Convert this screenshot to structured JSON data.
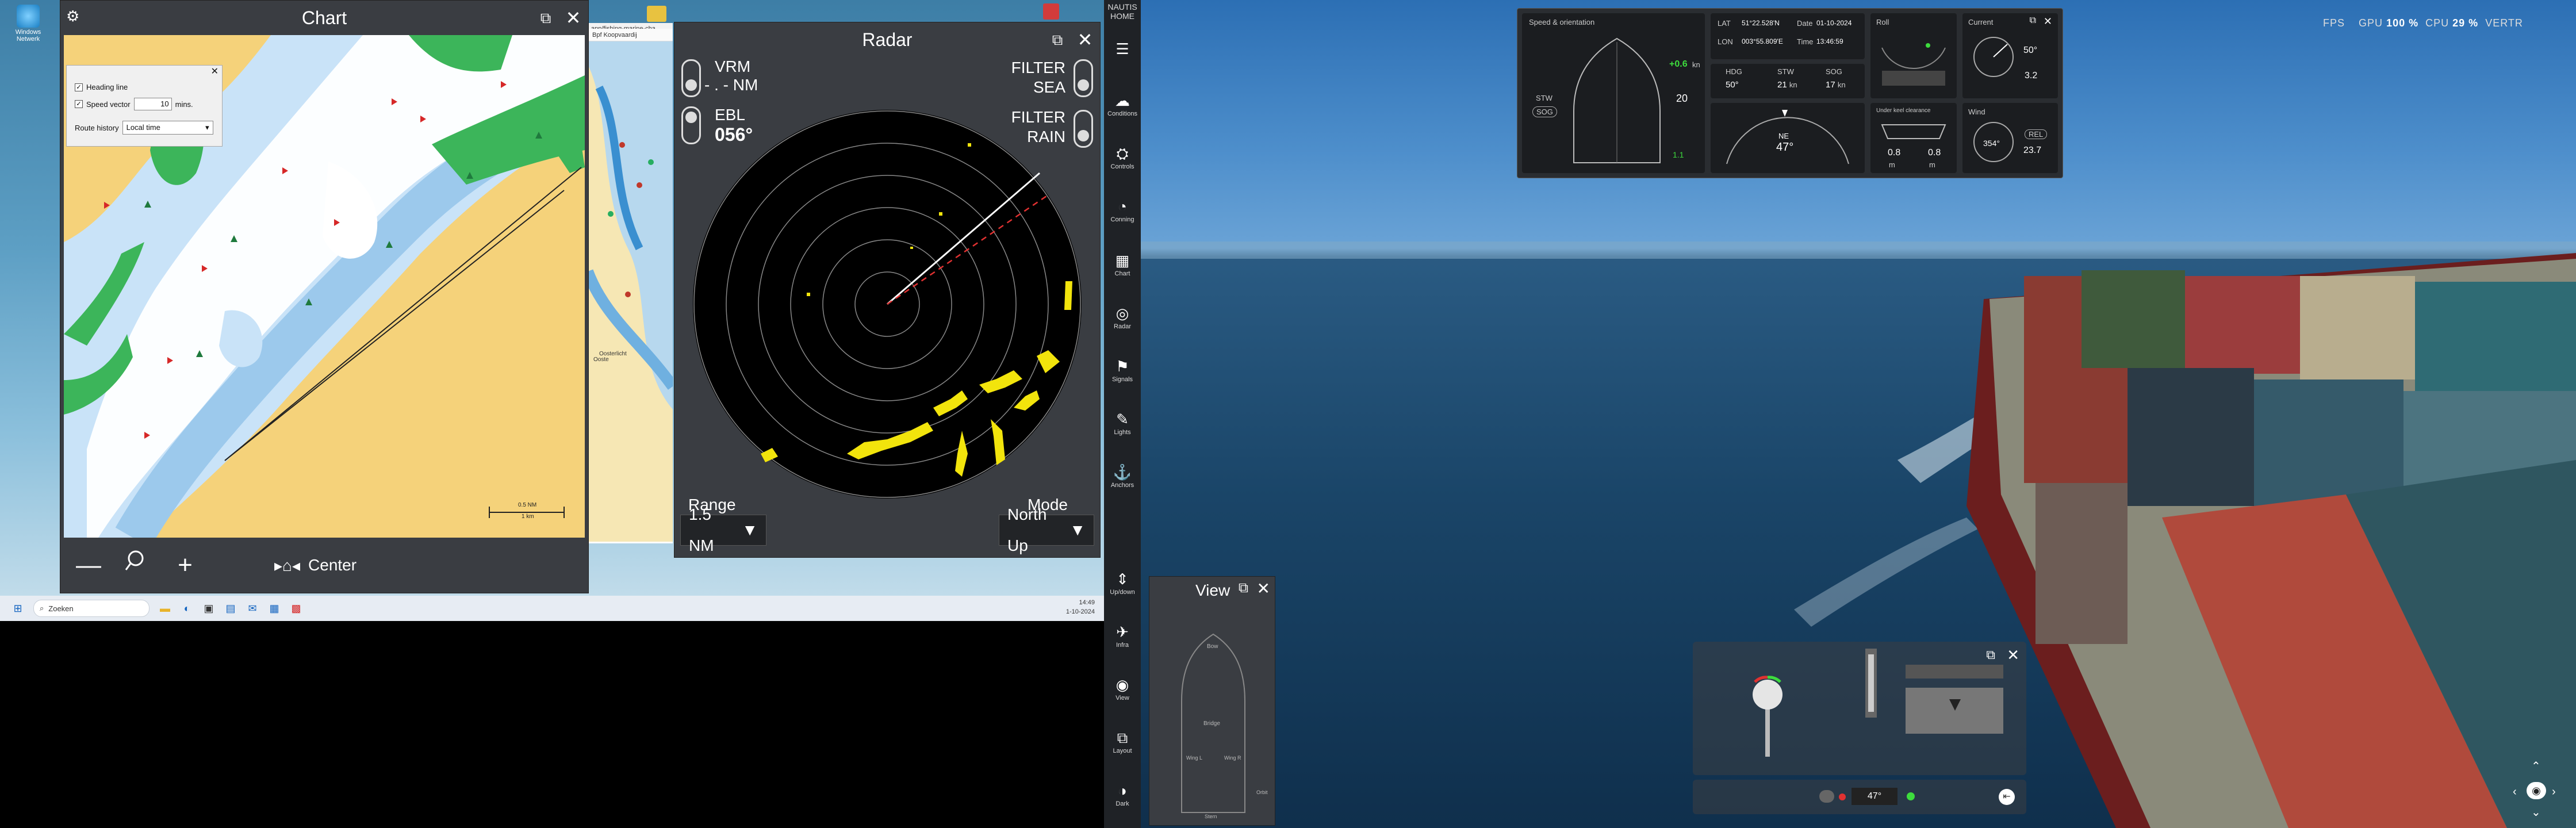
{
  "desktop": {
    "icons": [
      {
        "label": "Windows\nNetwerk",
        "color": "#3aa0e0"
      }
    ],
    "taskbar": {
      "search_placeholder": "Zoeken",
      "clock_time": "14:49",
      "clock_date": "1-10-2024"
    }
  },
  "chart_window": {
    "title": "Chart",
    "settings": {
      "heading_line_label": "Heading line",
      "speed_vector_label": "Speed vector",
      "speed_vector_value": "10",
      "speed_vector_unit": "mins.",
      "route_history_label": "Route history",
      "route_history_value": "Local time"
    },
    "scale_label_top": "0.5 NM",
    "scale_label_bottom": "1 km",
    "toolbar": {
      "center_label": "Center"
    }
  },
  "browser": {
    "url_text": "app/fishing-marine-cha",
    "bookmark_text": "Bpf Koopvaardij",
    "labels": [
      "Oosterlicht",
      "Ooste"
    ]
  },
  "radar_window": {
    "title": "Radar",
    "vrm_label": "VRM",
    "vrm_value": "- . - NM",
    "ebl_label": "EBL",
    "ebl_value": "056°",
    "filter_sea_label_1": "FILTER",
    "filter_sea_label_2": "SEA",
    "filter_rain_label_1": "FILTER",
    "filter_rain_label_2": "RAIN",
    "range_label": "Range",
    "range_value": "1.5 NM",
    "mode_label": "Mode",
    "mode_value": "North Up"
  },
  "rail": {
    "app_name_1": "NAUTIS",
    "app_name_2": "HOME",
    "items": [
      "Conditions",
      "Controls",
      "Conning",
      "Chart",
      "Radar",
      "Signals",
      "Lights",
      "Anchors",
      "Up/down",
      "Infra",
      "View",
      "Layout",
      "Dark"
    ]
  },
  "conning": {
    "speed_title": "Speed & orientation",
    "stw_label": "STW",
    "sog_label": "SOG",
    "speed_value": "+0.6",
    "speed_unit": "kn",
    "speed_big": "20",
    "speed_small": "1.1",
    "position_lat_label": "LAT",
    "position_lat": "51°22.528'N",
    "position_lon_label": "LON",
    "position_lon": "003°55.809'E",
    "date_label": "Date",
    "date_value": "01-10-2024",
    "time_label": "Time",
    "time_value": "13:46:59",
    "val_a_label": "HDG",
    "val_a": "50°",
    "val_b_label": "STW",
    "val_b": "21",
    "val_c_label": "SOG",
    "val_c": "17",
    "unit_kn": "kn",
    "roll_label": "Roll",
    "heading_readout": "47°",
    "heading_label": "NE",
    "wind_title": "Wind",
    "wind_dir": "354°",
    "wind_rel": "REL",
    "wind_speed": "23.7",
    "current_title": "Current",
    "current_dir": "50°",
    "current_speed": "3.2",
    "under_keel_title": "Under keel clearance",
    "ukc_fwd": "0.8",
    "ukc_aft": "0.8",
    "ukc_unit": "m"
  },
  "view_window": {
    "title": "View",
    "labels": [
      "Bow",
      "Bridge",
      "Wing L",
      "Stern",
      "Wing R",
      "Orbit"
    ]
  },
  "controls": {
    "heading_readout": "47°"
  },
  "perf": {
    "fps_label": "FPS",
    "gpu_label": "GPU",
    "gpu_value": "100 %",
    "cpu_label": "CPU",
    "cpu_value": "29 %",
    "vertr_label": "VERTR"
  }
}
